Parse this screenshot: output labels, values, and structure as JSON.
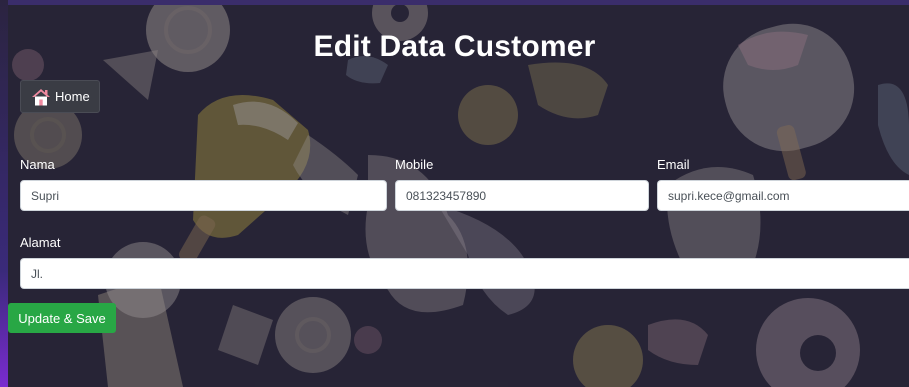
{
  "page": {
    "title": "Edit Data Customer"
  },
  "nav": {
    "home_label": "Home",
    "home_icon": "house-icon"
  },
  "form": {
    "nama": {
      "label": "Nama",
      "value": "Supri"
    },
    "mobile": {
      "label": "Mobile",
      "value": "081323457890"
    },
    "email": {
      "label": "Email",
      "value": "supri.kece@gmail.com"
    },
    "alamat": {
      "label": "Alamat",
      "value": "Jl."
    },
    "submit_label": "Update & Save"
  },
  "colors": {
    "submit": "#28a745",
    "home_button": "#3a3c44",
    "icon_roof": "#f08aa0"
  }
}
